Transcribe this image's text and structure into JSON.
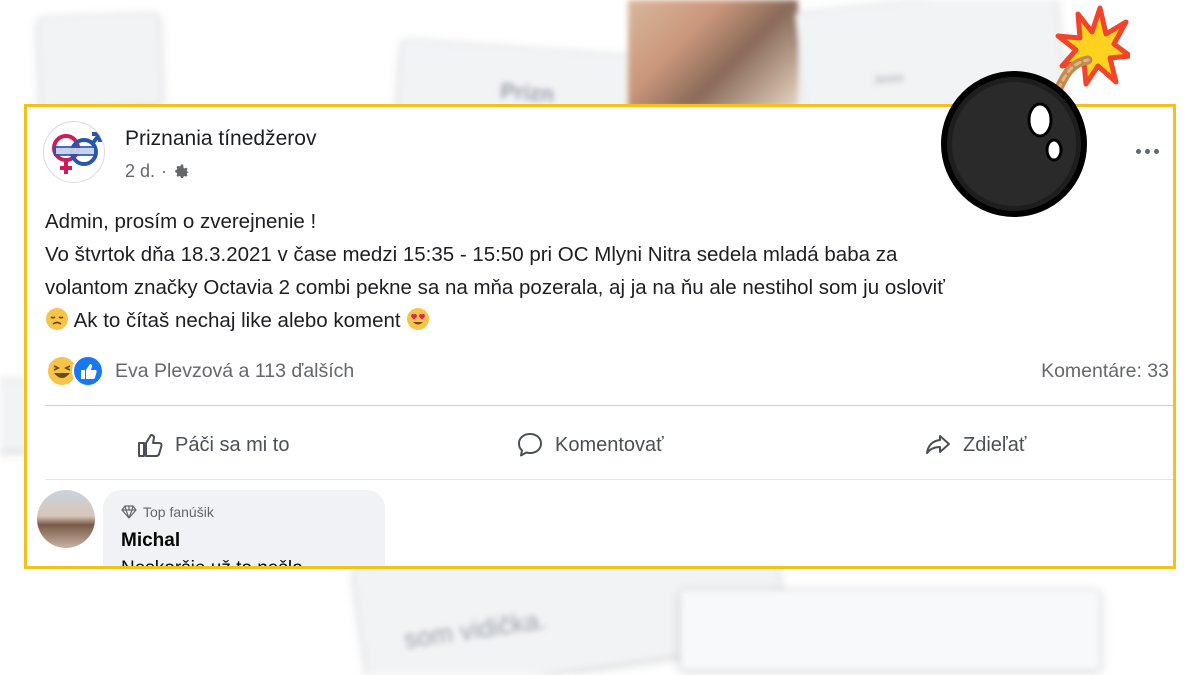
{
  "post": {
    "author": "Priznania tínedžerov",
    "time": "2 d.",
    "body_lines": [
      "Admin, prosím o zverejnenie !",
      "Vo štvrtok dňa 18.3.2021 v čase medzi 15:35 - 15:50 pri OC Mlyni Nitra sedela mladá baba za",
      "volantom značky Octavia 2 combi pekne sa na mňa pozerala, aj ja na ňu ale nestihol som ju osloviť",
      "Ak to čítaš nechaj like alebo koment"
    ],
    "reactions_text": "Eva Plevzová a 113 ďalších",
    "comments_count": "Komentáre: 33",
    "actions": {
      "like": "Páči sa mi to",
      "comment": "Komentovať",
      "share": "Zdieľať"
    }
  },
  "comment": {
    "badge": "Top fanúšik",
    "name": "Michal",
    "text_partial": "Neskoršie už to nešlo"
  },
  "background": {
    "fragment_1": "Prizn",
    "fragment_2": "Jesss",
    "fragment_3": "som vidička."
  },
  "colors": {
    "highlight_border": "#f2c21b",
    "link_like": "#1877f2"
  },
  "icons": {
    "settings": "gear-icon",
    "more": "ellipsis-icon",
    "like": "thumbs-up-icon",
    "comment": "speech-bubble-icon",
    "share": "share-arrow-icon",
    "badge": "diamond-icon",
    "overlay": "bomb-icon"
  }
}
